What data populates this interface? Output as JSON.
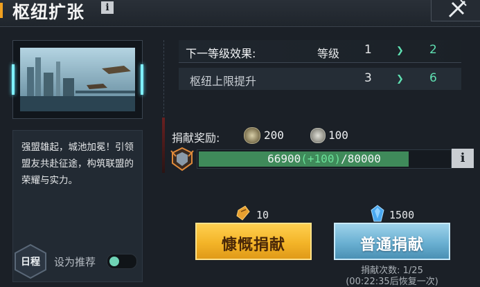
{
  "header": {
    "title": "枢纽扩张",
    "info_label": "i"
  },
  "left": {
    "description": "强盟雄起，城池加冕！引领盟友共赴征途，构筑联盟的荣耀与实力。",
    "schedule_label": "日程",
    "recommend_label": "设为推荐",
    "recommend_on": true
  },
  "effects": {
    "next_level_label": "下一等级效果:",
    "level_word": "等级",
    "level_from": "1",
    "level_to": "2",
    "limit_label": "枢纽上限提升",
    "limit_from": "3",
    "limit_to": "6"
  },
  "reward": {
    "label": "捐献奖励:",
    "coin1_value": "200",
    "coin2_value": "100"
  },
  "progress": {
    "current": "66900",
    "plus": "(+100)",
    "total": "/80000",
    "fraction": 0.836,
    "info_label": "i"
  },
  "donate": {
    "generous_cost": "10",
    "generous_label": "慷慨捐献",
    "normal_cost": "1500",
    "normal_label": "普通捐献",
    "count_text": "捐献次数: 1/25",
    "recover_text": "(00:22:35后恢复一次)"
  },
  "colors": {
    "accent_green": "#5fe0b2",
    "gold": "#f3b428",
    "blue": "#6ab0d2"
  }
}
